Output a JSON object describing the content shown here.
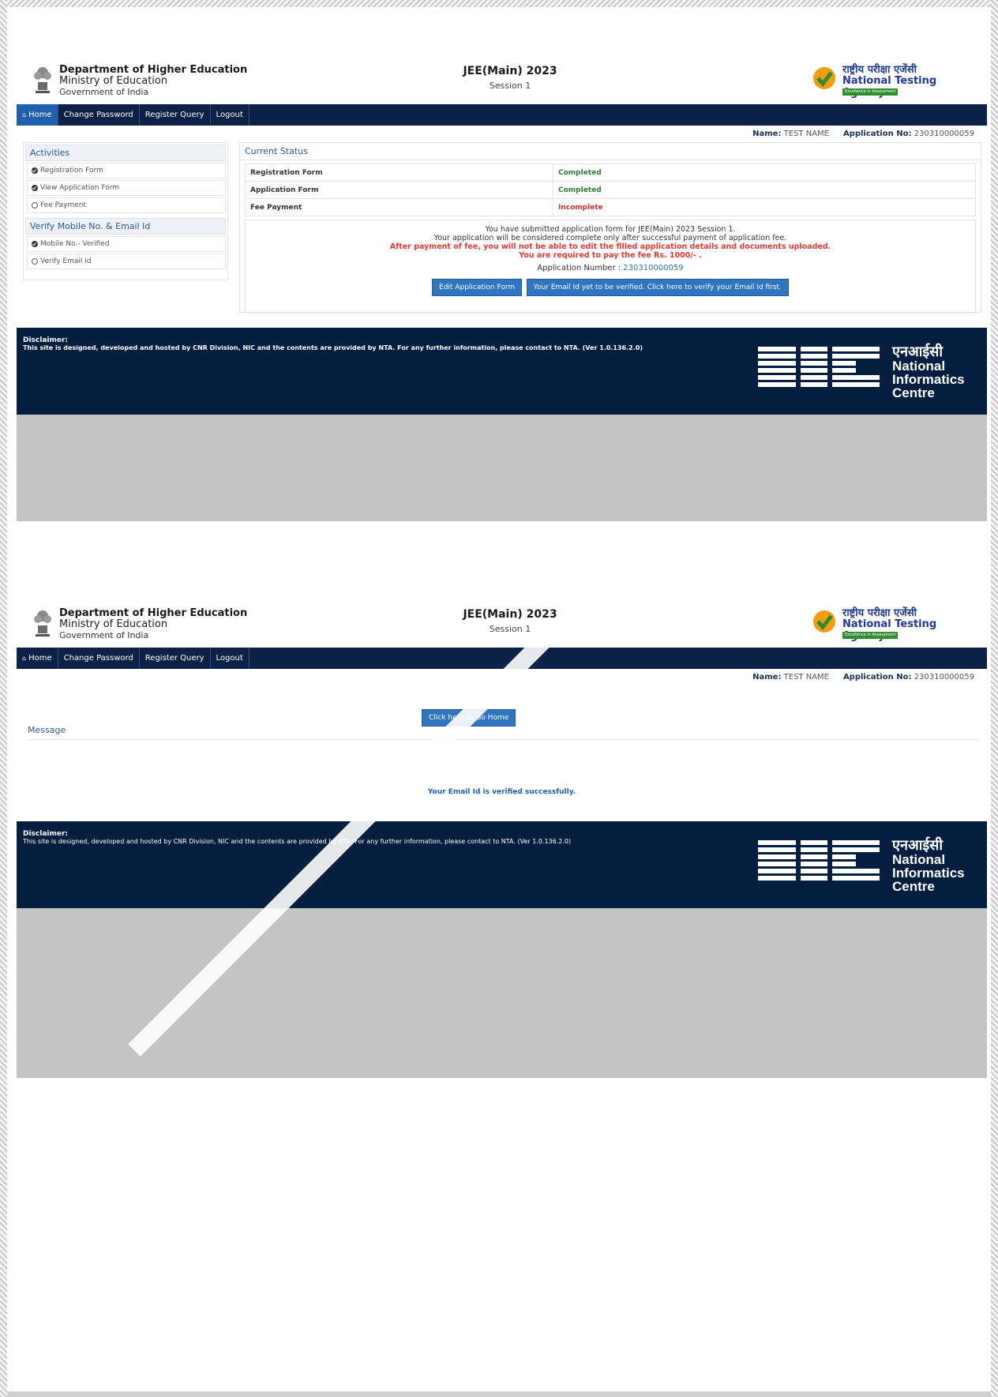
{
  "header": {
    "dept_title": "Department of Higher Education",
    "dept_ministry": "Ministry of Education",
    "dept_gov": "Government of India",
    "exam_title": "JEE(Main) 2023",
    "exam_session": "Session 1",
    "nta_hindi": "राष्ट्रीय परीक्षा एजेंसी",
    "nta_english": "National Testing Agency",
    "nta_tagline": "Excellence in Assessment"
  },
  "nav": {
    "items": [
      {
        "label": "Home",
        "icon": "home-icon"
      },
      {
        "label": "Change Password"
      },
      {
        "label": "Register Query"
      },
      {
        "label": "Logout"
      }
    ]
  },
  "user": {
    "name_label": "Name:",
    "name_value": "TEST NAME",
    "app_label": "Application No:",
    "app_value": "230310000059"
  },
  "sidebar": {
    "activities_title": "Activities",
    "activities": [
      {
        "label": "Registration Form",
        "done": true
      },
      {
        "label": "View Application Form",
        "done": true
      },
      {
        "label": "Fee Payment",
        "done": false
      }
    ],
    "verify_title": "Verify Mobile No. & Email Id",
    "verify_items": [
      {
        "label": "Mobile No.- Verified",
        "done": true
      },
      {
        "label": "Verify Email Id",
        "done": false
      }
    ]
  },
  "status": {
    "title": "Current Status",
    "rows": [
      {
        "label": "Registration Form",
        "value": "Completed",
        "state": "ok"
      },
      {
        "label": "Application Form",
        "value": "Completed",
        "state": "ok"
      },
      {
        "label": "Fee Payment",
        "value": "Incomplete",
        "state": "bad"
      }
    ],
    "notice_1": "You have submitted application form for JEE(Main) 2023 Session 1.",
    "notice_2": "Your application will be considered complete only after successful payment of application fee.",
    "notice_3": "After payment of fee, you will not be able to edit the filled application details and documents uploaded.",
    "notice_4": "You are required to pay the fee Rs. 1000/- .",
    "app_number_label": "Application Number :",
    "app_number_value": "230310000059",
    "edit_button": "Edit Application Form",
    "verify_button": "Your Email Id yet to be verified. Click here to verify your Email Id first."
  },
  "footer": {
    "disclaimer_title": "Disclaimer:",
    "disclaimer_text": "This site is designed, developed and hosted by CNR Division, NIC and the contents are provided by NTA. For any further information, please contact to NTA. (Ver 1.0.136.2.0)",
    "nic_hindi": "एनआईसी",
    "nic_line1": "National",
    "nic_line2": "Informatics",
    "nic_line3": "Centre"
  },
  "message_page": {
    "go_home_button": "Click here to Go Home",
    "title": "Message",
    "text": "Your Email Id is verified successfully."
  },
  "colors": {
    "navbar": "#0c2147",
    "footer": "#031e3f",
    "button": "#2f75c0",
    "success": "#2e7d32",
    "error": "#d32f2f"
  }
}
